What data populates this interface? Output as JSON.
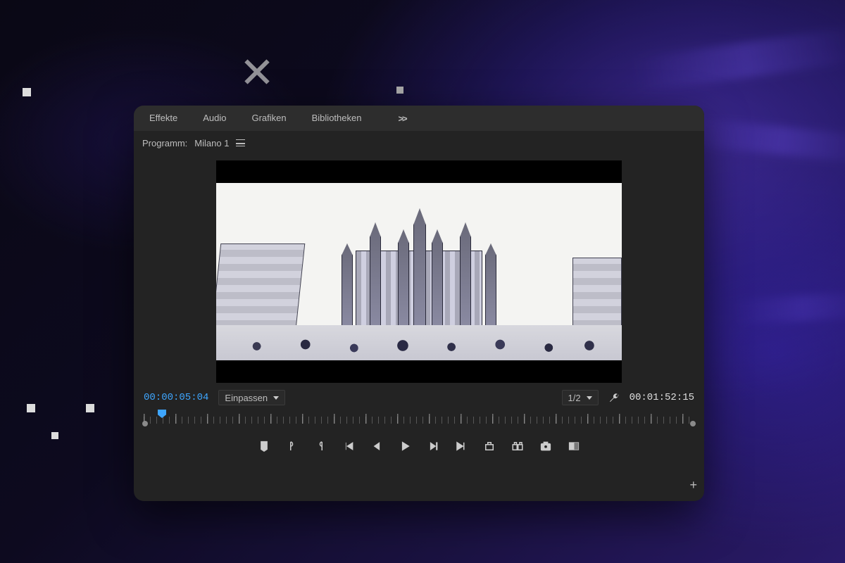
{
  "tabs": {
    "t0": "Effekte",
    "t1": "Audio",
    "t2": "Grafiken",
    "t3": "Bibliotheken",
    "overflow": ">>"
  },
  "program": {
    "label_prefix": "Programm:",
    "sequence_name": "Milano 1"
  },
  "viewer": {
    "current_time": "00:00:05:04",
    "total_time": "00:01:52:15",
    "fit_label": "Einpassen",
    "resolution_label": "1/2"
  },
  "transport": {
    "marker": "Marker",
    "in": "In-Point",
    "out": "Out-Point",
    "goto_in": "Zu In-Point",
    "step_back": "Schritt zurück",
    "play": "Abspielen",
    "step_fwd": "Schritt vor",
    "goto_out": "Zu Out-Point",
    "lift": "Herausnehmen",
    "extract": "Extrahieren",
    "snapshot": "Frame exportieren",
    "compare": "Vergleichsansicht",
    "add_btn": "+"
  },
  "colors": {
    "accent": "#3ea6ff",
    "panel": "#232323"
  }
}
